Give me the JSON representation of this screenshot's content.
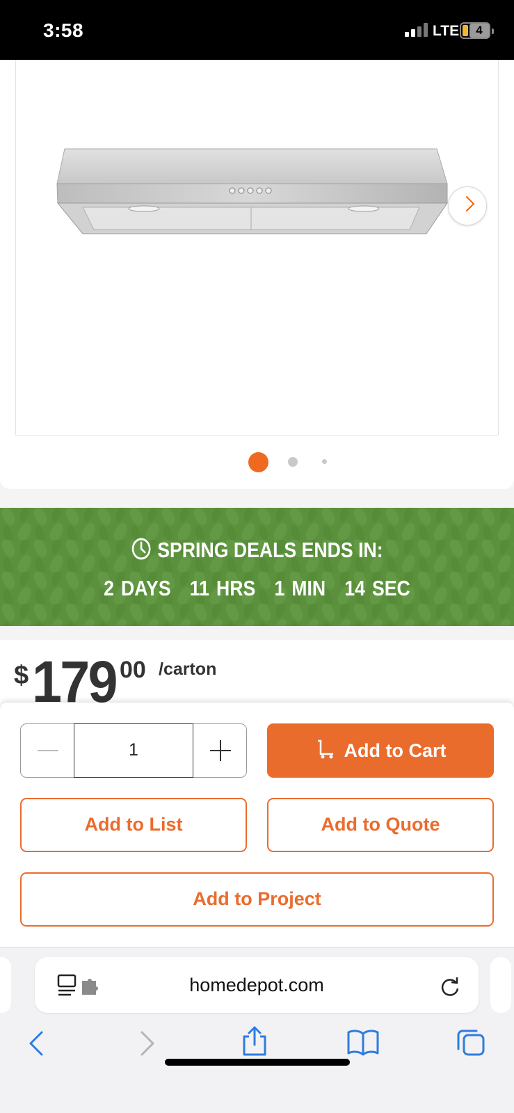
{
  "status_bar": {
    "time": "3:58",
    "network": "LTE",
    "battery": "4"
  },
  "product_media": {
    "image_alt": "Stainless steel under-cabinet range hood",
    "next_icon": "chevron-right-icon",
    "carousel": {
      "count": 3,
      "active_index": 0
    }
  },
  "promo_banner": {
    "title": "SPRING DEALS ENDS IN:",
    "icon": "clock-icon",
    "countdown": {
      "days": "2 DAYS",
      "hours": "11 HRS",
      "minutes": "1 MIN",
      "seconds": "14 SEC"
    },
    "color": "#5b913c"
  },
  "price": {
    "currency": "$",
    "dollars": "179",
    "cents": "00",
    "unit": "/carton"
  },
  "actions": {
    "quantity": "1",
    "add_to_cart": "Add to Cart",
    "add_to_list": "Add to List",
    "add_to_quote": "Add to Quote",
    "add_to_project": "Add to Project",
    "accent_color": "#ea6c2d"
  },
  "browser": {
    "url": "homedepot.com",
    "toolbar_icons": [
      "back-icon",
      "forward-icon",
      "share-icon",
      "bookmarks-icon",
      "tabs-icon"
    ]
  }
}
